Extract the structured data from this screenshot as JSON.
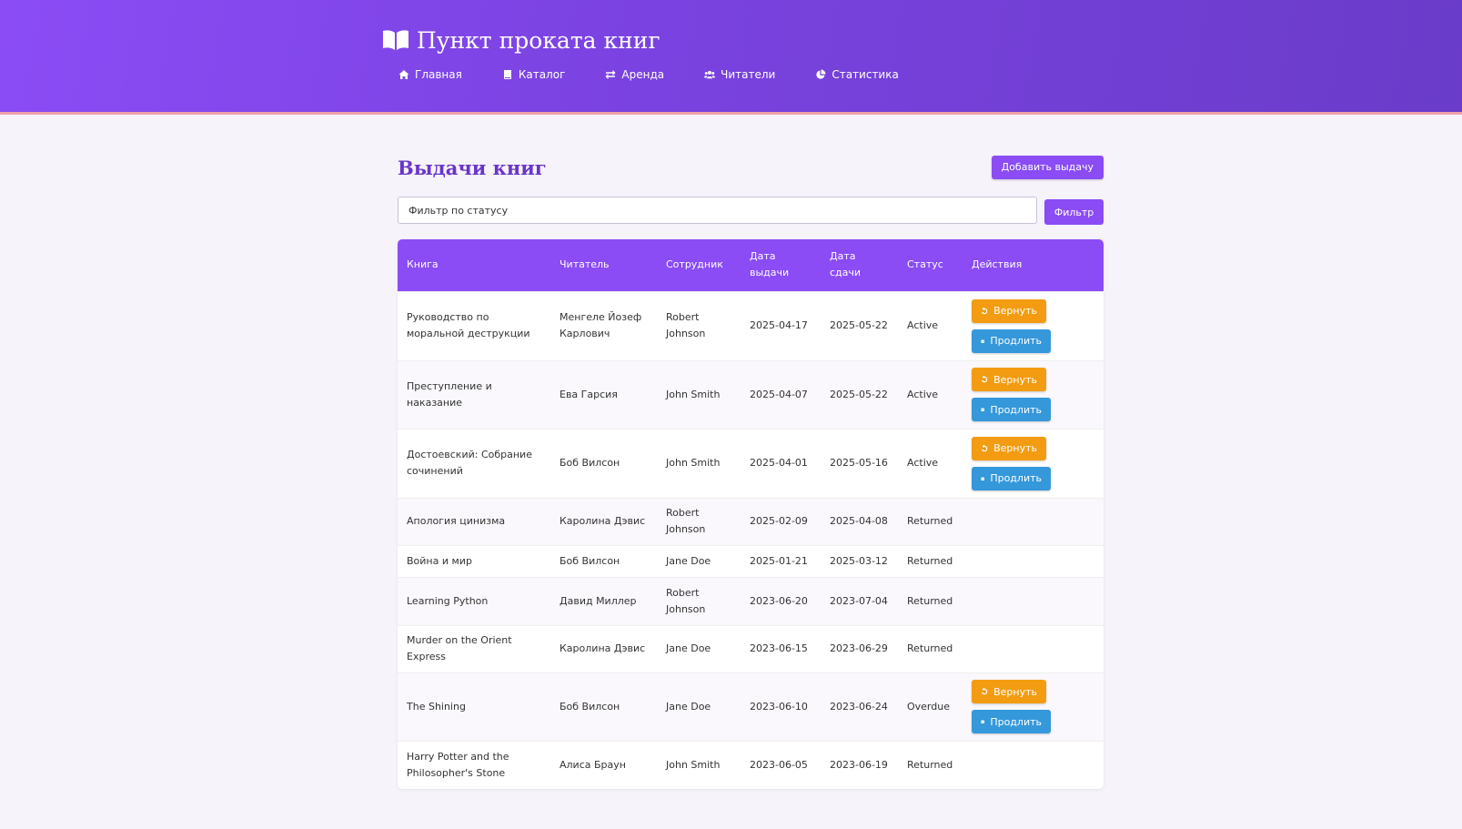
{
  "header": {
    "brand": "Пункт проката книг",
    "nav": [
      {
        "label": "Главная",
        "icon": "home-icon"
      },
      {
        "label": "Каталог",
        "icon": "book-icon"
      },
      {
        "label": "Аренда",
        "icon": "exchange-icon"
      },
      {
        "label": "Читатели",
        "icon": "users-icon"
      },
      {
        "label": "Статистика",
        "icon": "chart-pie-icon"
      }
    ]
  },
  "page": {
    "title": "Выдачи книг",
    "add_button": "Добавить выдачу",
    "filter_placeholder": "Фильтр по статусу",
    "filter_button": "Фильтр"
  },
  "table": {
    "columns": [
      "Книга",
      "Читатель",
      "Сотрудник",
      "Дата выдачи",
      "Дата сдачи",
      "Статус",
      "Действия"
    ],
    "return_label": "Вернуть",
    "extend_label": "Продлить",
    "rows": [
      {
        "book": "Руководство по моральной деструкции",
        "reader": "Менгеле Йозеф Карлович",
        "staff": "Robert Johnson",
        "issued": "2025-04-17",
        "due": "2025-05-22",
        "status": "Active"
      },
      {
        "book": "Преступление и наказание",
        "reader": "Ева Гарсия",
        "staff": "John Smith",
        "issued": "2025-04-07",
        "due": "2025-05-22",
        "status": "Active"
      },
      {
        "book": "Достоевский: Собрание сочинений",
        "reader": "Боб Вилсон",
        "staff": "John Smith",
        "issued": "2025-04-01",
        "due": "2025-05-16",
        "status": "Active"
      },
      {
        "book": "Апология цинизма",
        "reader": "Каролина Дэвис",
        "staff": "Robert Johnson",
        "issued": "2025-02-09",
        "due": "2025-04-08",
        "status": "Returned"
      },
      {
        "book": "Война и мир",
        "reader": "Боб Вилсон",
        "staff": "Jane Doe",
        "issued": "2025-01-21",
        "due": "2025-03-12",
        "status": "Returned"
      },
      {
        "book": "Learning Python",
        "reader": "Давид Миллер",
        "staff": "Robert Johnson",
        "issued": "2023-06-20",
        "due": "2023-07-04",
        "status": "Returned"
      },
      {
        "book": "Murder on the Orient Express",
        "reader": "Каролина Дэвис",
        "staff": "Jane Doe",
        "issued": "2023-06-15",
        "due": "2023-06-29",
        "status": "Returned"
      },
      {
        "book": "The Shining",
        "reader": "Боб Вилсон",
        "staff": "Jane Doe",
        "issued": "2023-06-10",
        "due": "2023-06-24",
        "status": "Overdue"
      },
      {
        "book": "Harry Potter and the Philosopher's Stone",
        "reader": "Алиса Браун",
        "staff": "John Smith",
        "issued": "2023-06-05",
        "due": "2023-06-19",
        "status": "Returned"
      }
    ]
  },
  "colors": {
    "accent": "#8b4cf5",
    "title": "#6a35c9",
    "return_button": "#f39c12",
    "extend_button": "#3498db"
  }
}
